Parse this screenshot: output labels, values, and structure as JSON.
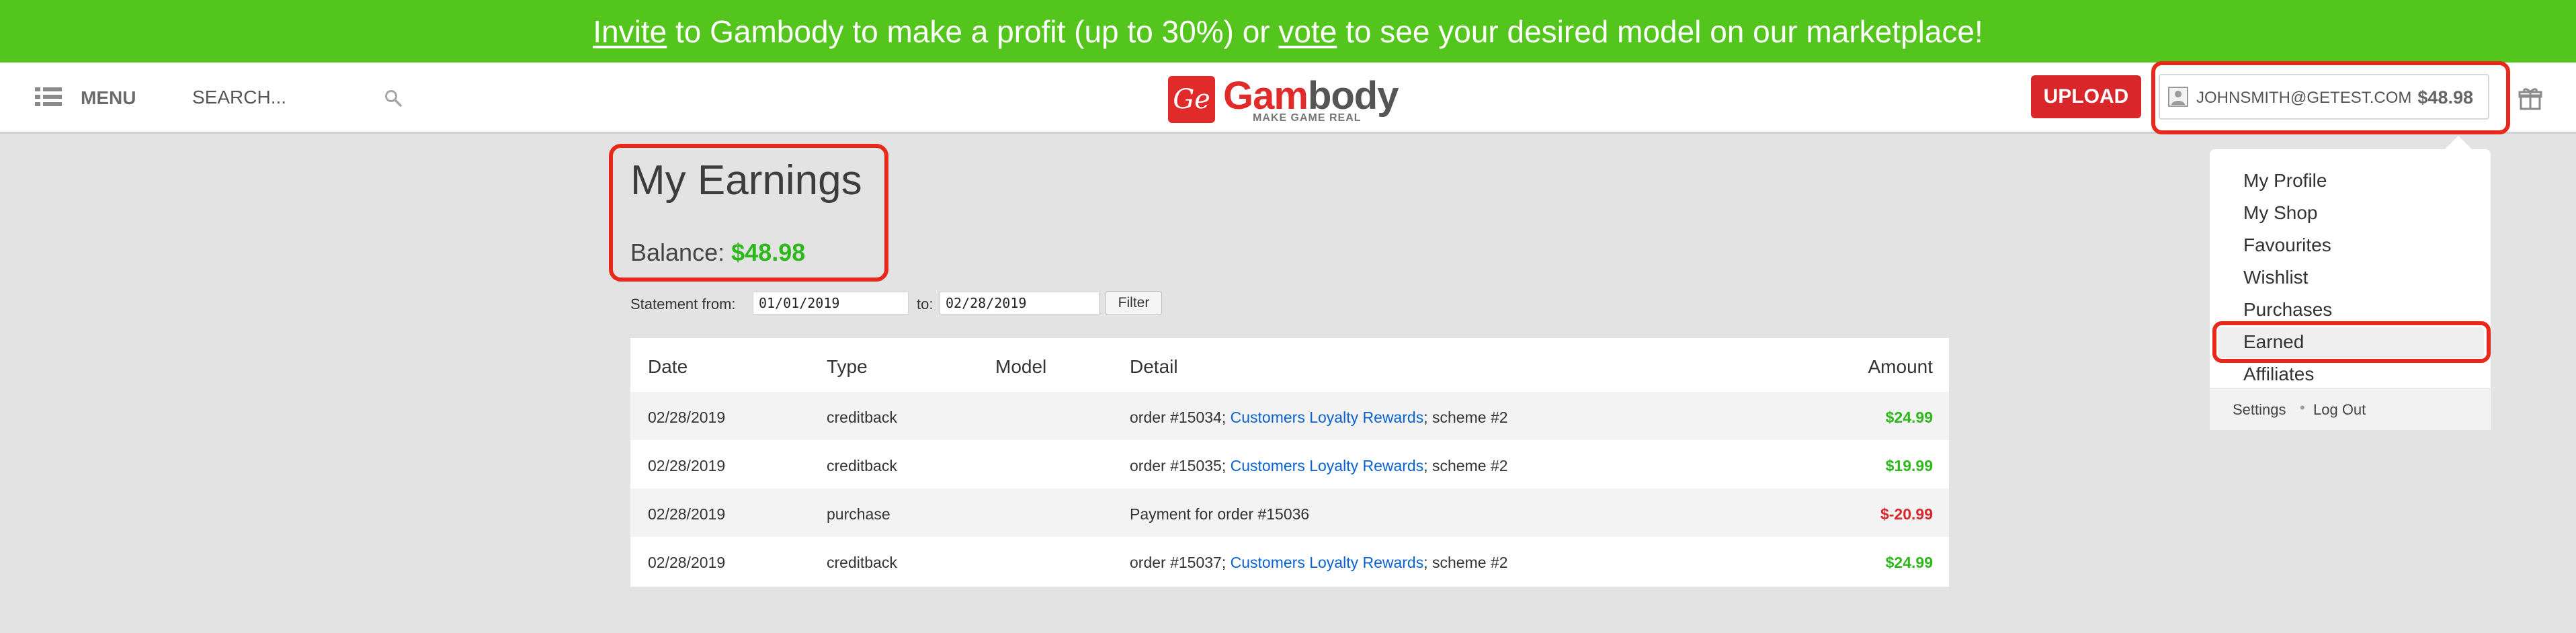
{
  "promo": {
    "invite": "Invite",
    "middle": " to Gambody to make a profit (up to 30%) or ",
    "vote": "vote",
    "end": " to see your desired model on our marketplace!"
  },
  "header": {
    "menu_label": "MENU",
    "search_placeholder": "SEARCH...",
    "logo_badge": "Ge",
    "logo_gam": "Gam",
    "logo_body": "body",
    "logo_tagline": "MAKE GAME REAL",
    "upload_label": "UPLOAD",
    "account_email": "JOHNSMITH@GETEST.COM",
    "account_balance": "$48.98"
  },
  "dropdown": {
    "items": [
      "My Profile",
      "My Shop",
      "Favourites",
      "Wishlist",
      "Purchases",
      "Earned",
      "Affiliates"
    ],
    "selected": "Earned",
    "footer": {
      "settings": "Settings",
      "separator": "•",
      "logout": "Log Out"
    }
  },
  "main": {
    "title": "My Earnings",
    "balance_label": "Balance:",
    "balance_value": "$48.98",
    "statement_from_label": "Statement from:",
    "statement_from_value": "01/01/2019",
    "statement_to_label": "to:",
    "statement_to_value": "02/28/2019",
    "filter_label": "Filter"
  },
  "table": {
    "headers": {
      "date": "Date",
      "type": "Type",
      "model": "Model",
      "detail": "Detail",
      "amount": "Amount"
    },
    "rows": [
      {
        "date": "02/28/2019",
        "type": "creditback",
        "model": "",
        "detail_prefix": "order #15034; ",
        "detail_link": "Customers Loyalty Rewards",
        "detail_suffix": "; scheme #2",
        "amount": "$24.99",
        "amount_sign": "positive"
      },
      {
        "date": "02/28/2019",
        "type": "creditback",
        "model": "",
        "detail_prefix": "order #15035; ",
        "detail_link": "Customers Loyalty Rewards",
        "detail_suffix": "; scheme #2",
        "amount": "$19.99",
        "amount_sign": "positive"
      },
      {
        "date": "02/28/2019",
        "type": "purchase",
        "model": "",
        "detail_prefix": "Payment for order #15036",
        "detail_link": "",
        "detail_suffix": "",
        "amount": "$-20.99",
        "amount_sign": "negative"
      },
      {
        "date": "02/28/2019",
        "type": "creditback",
        "model": "",
        "detail_prefix": "order #15037; ",
        "detail_link": "Customers Loyalty Rewards",
        "detail_suffix": "; scheme #2",
        "amount": "$24.99",
        "amount_sign": "positive"
      }
    ]
  },
  "colors": {
    "promo_bg": "#53c51c",
    "brand_red": "#e12b2b",
    "upload_bg": "#d9262b",
    "positive_amount": "#2cb81a",
    "negative_amount": "#d9262b",
    "link": "#0a62d0",
    "highlight_outline": "#e8281b"
  },
  "icons": [
    "menu-icon",
    "search-icon",
    "user-icon",
    "gift-icon"
  ]
}
